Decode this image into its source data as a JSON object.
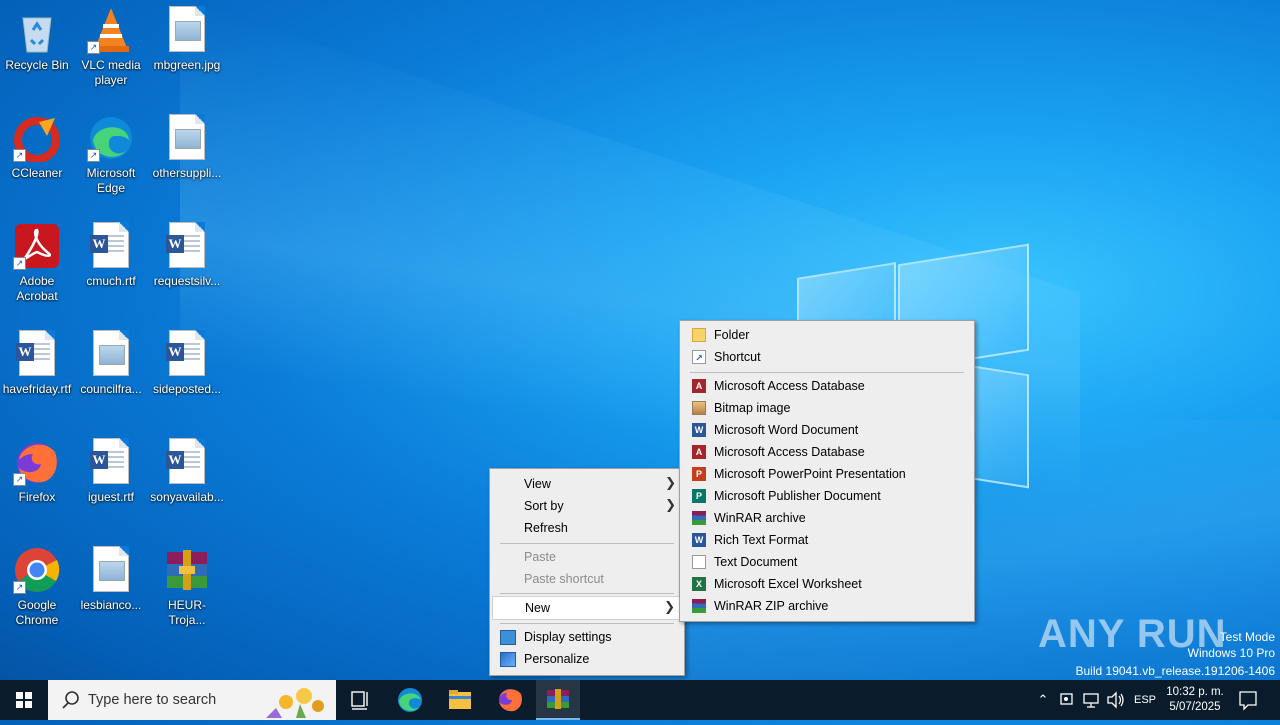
{
  "desktop": {
    "icons": [
      {
        "label": "Recycle Bin",
        "icon": "recycle-bin-icon"
      },
      {
        "label": "VLC media player",
        "icon": "vlc-icon"
      },
      {
        "label": "mbgreen.jpg",
        "icon": "image-file-icon"
      },
      {
        "label": "CCleaner",
        "icon": "ccleaner-icon"
      },
      {
        "label": "Microsoft Edge",
        "icon": "edge-icon"
      },
      {
        "label": "othersuppli...",
        "icon": "image-file-icon"
      },
      {
        "label": "Adobe Acrobat",
        "icon": "acrobat-icon"
      },
      {
        "label": "cmuch.rtf",
        "icon": "word-doc-icon"
      },
      {
        "label": "requestsilv...",
        "icon": "word-doc-icon"
      },
      {
        "label": "havefriday.rtf",
        "icon": "word-doc-icon"
      },
      {
        "label": "councilfra...",
        "icon": "image-file-icon"
      },
      {
        "label": "sideposted...",
        "icon": "word-doc-icon"
      },
      {
        "label": "Firefox",
        "icon": "firefox-icon"
      },
      {
        "label": "iguest.rtf",
        "icon": "word-doc-icon"
      },
      {
        "label": "sonyavailab...",
        "icon": "word-doc-icon"
      },
      {
        "label": "Google Chrome",
        "icon": "chrome-icon"
      },
      {
        "label": "lesbianco...",
        "icon": "image-file-icon"
      },
      {
        "label": "HEUR-Troja...",
        "icon": "winrar-icon"
      }
    ]
  },
  "context_menu": {
    "view": "View",
    "sort_by": "Sort by",
    "refresh": "Refresh",
    "paste": "Paste",
    "paste_shortcut": "Paste shortcut",
    "new": "New",
    "display_settings": "Display settings",
    "personalize": "Personalize"
  },
  "new_submenu": {
    "folder": "Folder",
    "shortcut": "Shortcut",
    "access_db_1": "Microsoft Access Database",
    "bitmap": "Bitmap image",
    "word": "Microsoft Word Document",
    "access_db_2": "Microsoft Access Database",
    "powerpoint": "Microsoft PowerPoint Presentation",
    "publisher": "Microsoft Publisher Document",
    "winrar": "WinRAR archive",
    "rtf": "Rich Text Format",
    "text": "Text Document",
    "excel": "Microsoft Excel Worksheet",
    "winrar_zip": "WinRAR ZIP archive"
  },
  "watermark": {
    "brand": "ANY RUN",
    "mode": "Test Mode",
    "os": "Windows 10 Pro",
    "build": "Build 19041.vb_release.191206-1406"
  },
  "taskbar": {
    "search_placeholder": "Type here to search",
    "language": "ESP",
    "time": "10:32 p. m.",
    "date": "5/07/2025"
  },
  "colors": {
    "taskbar": "#0a1b2c",
    "menu_bg": "#eeeeee",
    "desktop_accent": "#0a7bd8"
  }
}
